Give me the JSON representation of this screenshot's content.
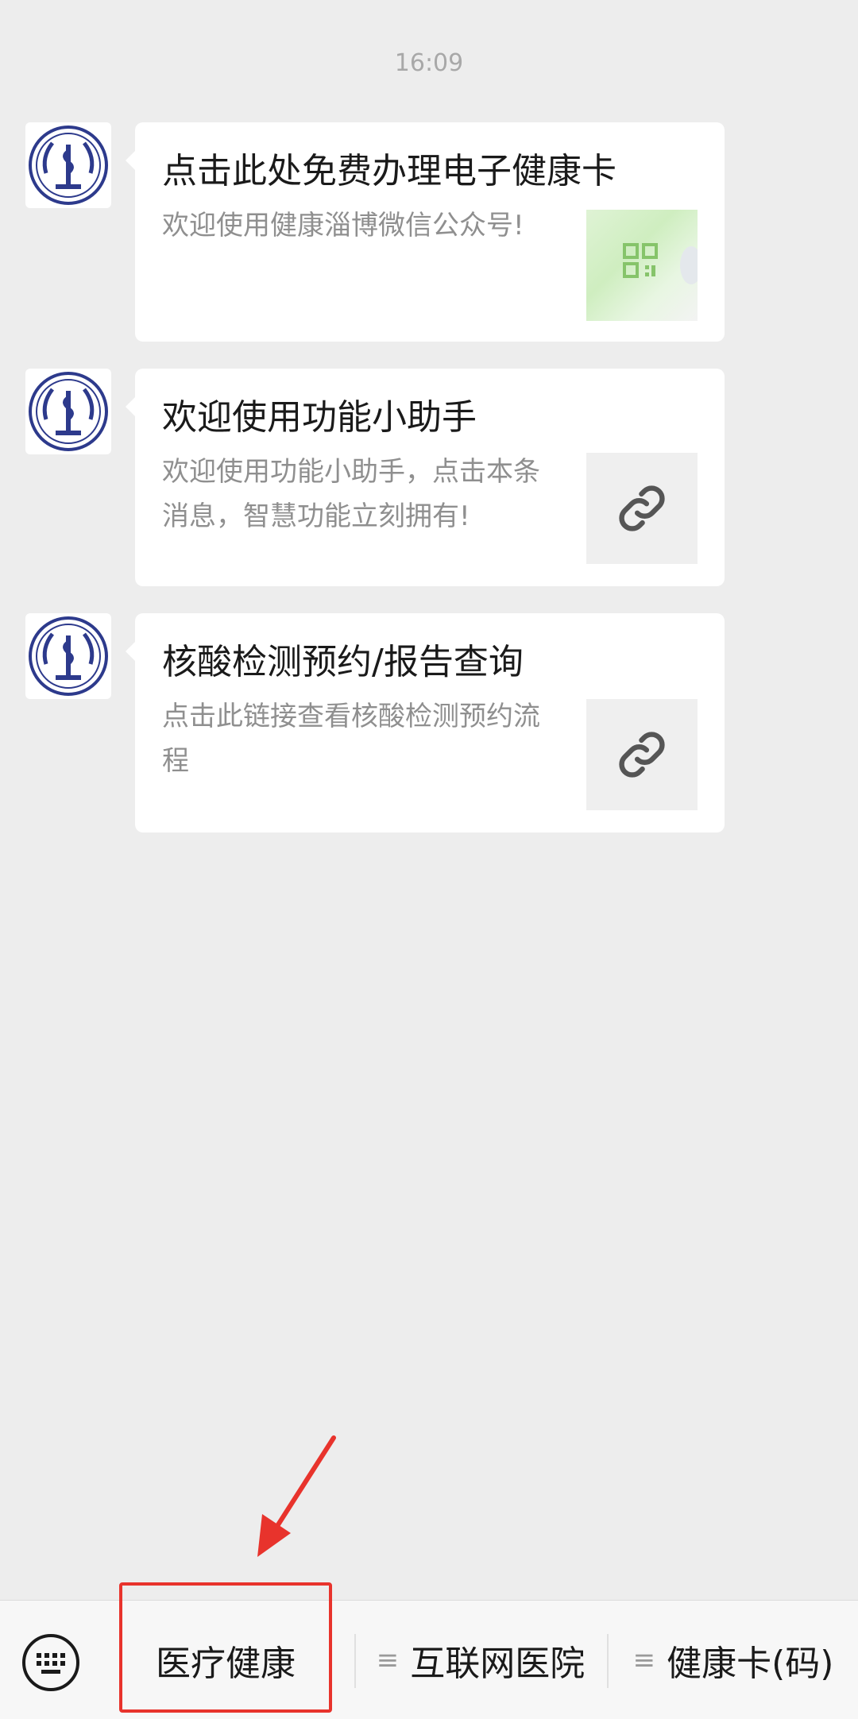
{
  "chat": {
    "timestamp": "16:09",
    "messages": [
      {
        "title": "点击此处免费办理电子健康卡",
        "description": "欢迎使用健康淄博微信公众号!",
        "thumbnail_icon": "qr-code-icon"
      },
      {
        "title": "欢迎使用功能小助手",
        "description": "欢迎使用功能小助手，点击本条消息，智慧功能立刻拥有!",
        "thumbnail_icon": "link-icon"
      },
      {
        "title": "核酸检测预约/报告查询",
        "description": "点击此链接查看核酸检测预约流程",
        "thumbnail_icon": "link-icon"
      }
    ]
  },
  "menu": {
    "keyboard_icon": "keyboard-icon",
    "items": [
      {
        "label": "医疗健康"
      },
      {
        "label": "互联网医院",
        "glyph": "≡"
      },
      {
        "label": "健康卡(码)",
        "glyph": "≡"
      }
    ]
  },
  "annotation": {
    "highlight_color": "#e8332c"
  }
}
